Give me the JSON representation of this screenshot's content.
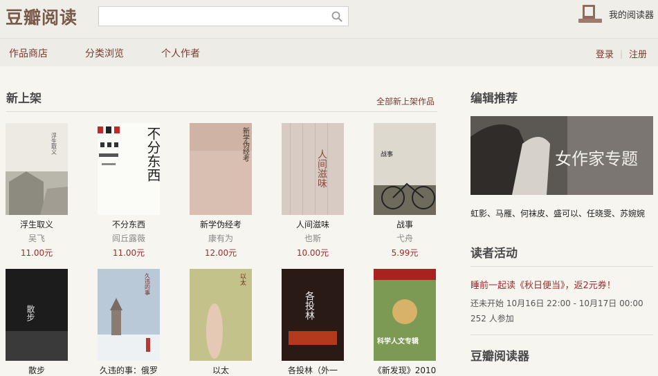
{
  "header": {
    "logo": "豆瓣阅读",
    "search_placeholder": "",
    "reader_label": "我的阅读器"
  },
  "nav": {
    "items": [
      "作品商店",
      "分类浏览",
      "个人作者"
    ],
    "login": "登录",
    "separator": "|",
    "register": "注册"
  },
  "new_arrivals": {
    "title": "新上架",
    "more_link": "全部新上架作品",
    "books_row1": [
      {
        "title": "浮生取义",
        "author": "吴飞",
        "price": "11.00元",
        "cover_text": "浮生取义"
      },
      {
        "title": "不分东西",
        "author": "闾丘露薇",
        "price": "11.00元",
        "cover_text": "不分东西"
      },
      {
        "title": "新学伪经考",
        "author": "康有为",
        "price": "12.00元",
        "cover_text": "新学伪经考"
      },
      {
        "title": "人间滋味",
        "author": "也斯",
        "price": "10.00元",
        "cover_text": "人间滋味"
      },
      {
        "title": "战事",
        "author": "弋舟",
        "price": "5.99元",
        "cover_text": "战事"
      }
    ],
    "books_row2": [
      {
        "title": "散步",
        "cover_text": "散步"
      },
      {
        "title": "久违的事：俄罗",
        "cover_text": "久违的事"
      },
      {
        "title": "以太",
        "cover_text": "以太"
      },
      {
        "title": "各投林（外一",
        "cover_text": "各投林"
      },
      {
        "title": "《新发现》2010",
        "cover_text": "科学人文专辑"
      }
    ]
  },
  "sidebar": {
    "editor_title": "编辑推荐",
    "banner_text": "女作家专题",
    "editor_list": "虹影、马雁、何袜皮、盛可以、任晓雯、苏婉婉",
    "activity_title": "读者活动",
    "event_title": "睡前一起读《秋日便当》，返2元券！",
    "event_time": "还未开始   10月16日 22:00 - 10月17日 00:00",
    "event_count": "252 人参加",
    "reader_title": "豆瓣阅读器"
  },
  "colors": {
    "brand": "#7a5b4b",
    "link": "#7a3b2e",
    "price": "#9b2d2d",
    "page_bg": "#f6f5ef"
  }
}
